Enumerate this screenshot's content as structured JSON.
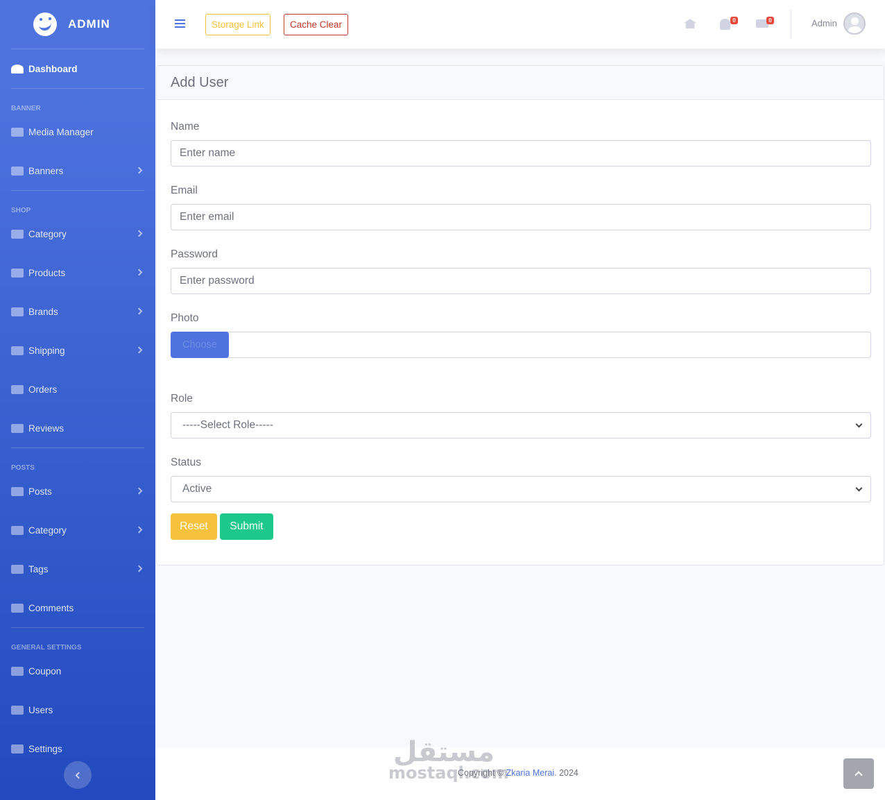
{
  "brand": {
    "name": "ADMIN",
    "logo_icon": "laughing-face-icon"
  },
  "sidebar": {
    "dashboard": {
      "label": "Dashboard",
      "icon": "tachometer-icon"
    },
    "sections": [
      {
        "heading": "BANNER",
        "items": [
          {
            "label": "Media Manager",
            "icon": "chart-area-icon",
            "has_submenu": false
          },
          {
            "label": "Banners",
            "icon": "image-icon",
            "has_submenu": true
          }
        ]
      },
      {
        "heading": "SHOP",
        "items": [
          {
            "label": "Category",
            "icon": "sitemap-icon",
            "has_submenu": true
          },
          {
            "label": "Products",
            "icon": "cubes-icon",
            "has_submenu": true
          },
          {
            "label": "Brands",
            "icon": "table-icon",
            "has_submenu": true
          },
          {
            "label": "Shipping",
            "icon": "truck-icon",
            "has_submenu": true
          },
          {
            "label": "Orders",
            "icon": "hammer-icon",
            "has_submenu": false
          },
          {
            "label": "Reviews",
            "icon": "comments-icon",
            "has_submenu": false
          }
        ]
      },
      {
        "heading": "POSTS",
        "items": [
          {
            "label": "Posts",
            "icon": "folder-icon",
            "has_submenu": true
          },
          {
            "label": "Category",
            "icon": "sitemap-icon",
            "has_submenu": true
          },
          {
            "label": "Tags",
            "icon": "tags-icon",
            "has_submenu": true
          },
          {
            "label": "Comments",
            "icon": "comments-icon",
            "has_submenu": false
          }
        ]
      },
      {
        "heading": "GENERAL SETTINGS",
        "items": [
          {
            "label": "Coupon",
            "icon": "table-icon",
            "has_submenu": false
          },
          {
            "label": "Users",
            "icon": "users-icon",
            "has_submenu": false
          },
          {
            "label": "Settings",
            "icon": "cog-icon",
            "has_submenu": false
          }
        ]
      }
    ]
  },
  "topbar": {
    "storage_link": "Storage Link",
    "cache_clear": "Cache Clear",
    "notifications_count": "0",
    "messages_count": "0",
    "user_name": "Admin"
  },
  "form": {
    "title": "Add User",
    "name": {
      "label": "Name",
      "placeholder": "Enter name"
    },
    "email": {
      "label": "Email",
      "placeholder": "Enter email"
    },
    "password": {
      "label": "Password",
      "placeholder": "Enter password"
    },
    "photo": {
      "label": "Photo",
      "button": "Choose"
    },
    "role": {
      "label": "Role",
      "selected": "-----Select Role-----"
    },
    "status": {
      "label": "Status",
      "selected": "Active"
    },
    "reset": "Reset",
    "submit": "Submit"
  },
  "footer": {
    "copyright_prefix": "Copyright © ",
    "author": "Zkaria Merai",
    "year_suffix": ". 2024",
    "watermark_ar": "مستقل",
    "watermark_latin": "mostaql.com"
  },
  "colors": {
    "primary": "#4e73df",
    "warning": "#f6c23e",
    "success": "#1cc88a",
    "danger": "#e74a3b"
  }
}
